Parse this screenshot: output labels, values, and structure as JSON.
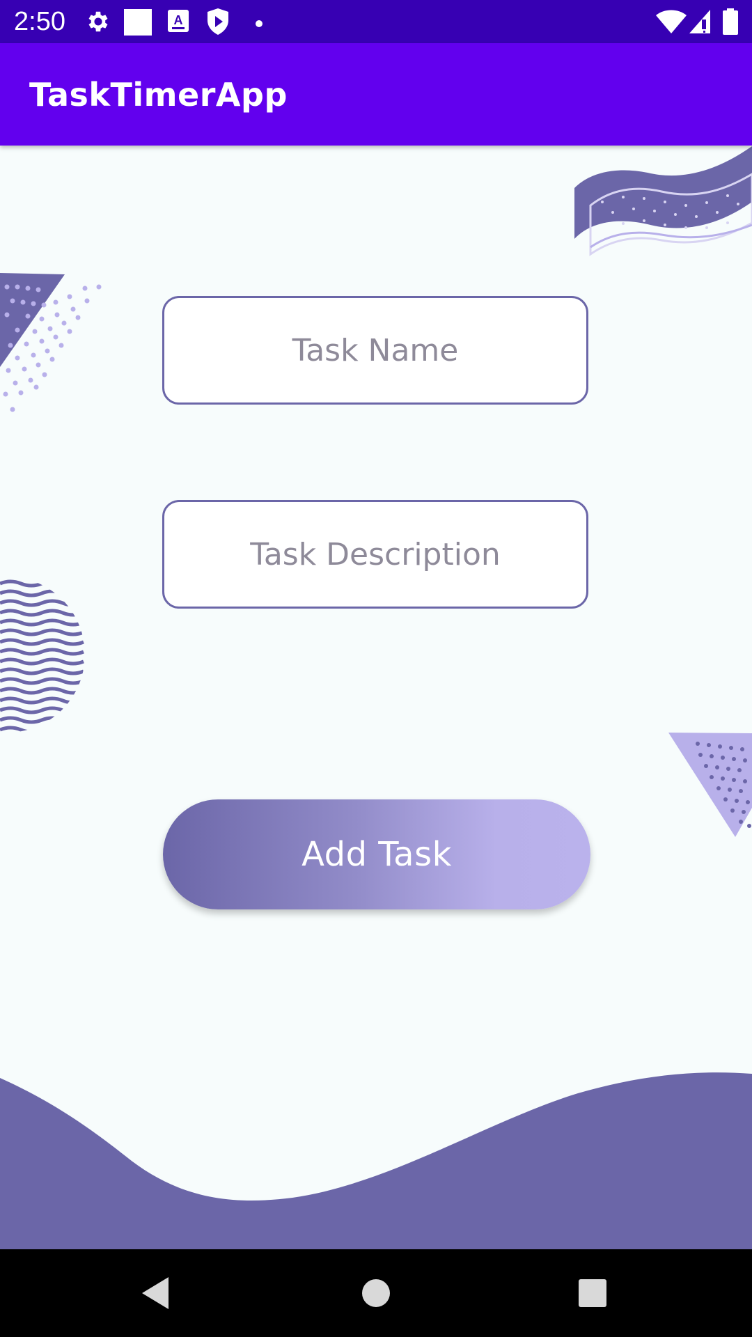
{
  "status_bar": {
    "time": "2:50",
    "left_icons": [
      "gear-icon",
      "square-icon",
      "keyboard-a-icon",
      "shield-play-icon",
      "dot-icon"
    ],
    "right_icons": [
      "wifi-icon",
      "signal-icon",
      "battery-icon"
    ]
  },
  "app_bar": {
    "title": "TaskTimerApp"
  },
  "form": {
    "task_name_placeholder": "Task Name",
    "task_name_value": "",
    "task_description_placeholder": "Task Description",
    "task_description_value": "",
    "add_button_label": "Add Task"
  },
  "nav_bar": {
    "buttons": [
      "back-icon",
      "home-icon",
      "recents-icon"
    ]
  },
  "colors": {
    "status_bar": "#3700b3",
    "app_bar": "#6200ee",
    "accent": "#6b66a8",
    "accent_light": "#b8b0ea",
    "background": "#f7fcfc"
  }
}
